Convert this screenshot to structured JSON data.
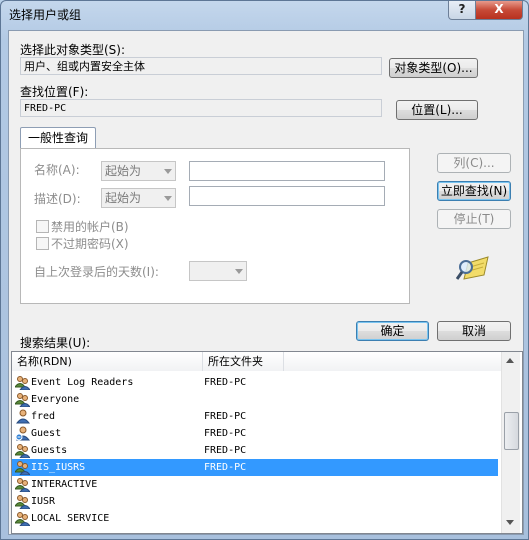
{
  "window": {
    "title": "选择用户或组",
    "help_label": "?",
    "close_label": "X"
  },
  "object_type": {
    "label": "选择此对象类型(S):",
    "value": "用户、组或内置安全主体",
    "button": "对象类型(O)..."
  },
  "location": {
    "label": "查找位置(F):",
    "value": "FRED-PC",
    "button": "位置(L)..."
  },
  "query": {
    "tab": "一般性查询",
    "name_label": "名称(A):",
    "name_mode": "起始为",
    "desc_label": "描述(D):",
    "desc_mode": "起始为",
    "disabled_accounts": "禁用的帐户(B)",
    "no_expire_password": "不过期密码(X)",
    "days_since_logon": "自上次登录后的天数(I):"
  },
  "side_buttons": {
    "columns": "列(C)...",
    "find_now": "立即查找(N)",
    "stop": "停止(T)"
  },
  "dialog_buttons": {
    "ok": "确定",
    "cancel": "取消"
  },
  "results": {
    "label": "搜索结果(U):",
    "columns": [
      "名称(RDN)",
      "所在文件夹"
    ],
    "rows": [
      {
        "name": "Event Log Readers",
        "folder": "FRED-PC",
        "icon": "group-icon",
        "selected": false
      },
      {
        "name": "Everyone",
        "folder": "",
        "icon": "group-icon",
        "selected": false
      },
      {
        "name": "fred",
        "folder": "FRED-PC",
        "icon": "user-icon",
        "selected": false
      },
      {
        "name": "Guest",
        "folder": "FRED-PC",
        "icon": "user-disabled-icon",
        "selected": false
      },
      {
        "name": "Guests",
        "folder": "FRED-PC",
        "icon": "group-icon",
        "selected": false
      },
      {
        "name": "IIS_IUSRS",
        "folder": "FRED-PC",
        "icon": "group-icon",
        "selected": true
      },
      {
        "name": "INTERACTIVE",
        "folder": "",
        "icon": "group-icon",
        "selected": false
      },
      {
        "name": "IUSR",
        "folder": "",
        "icon": "group-icon",
        "selected": false
      },
      {
        "name": "LOCAL SERVICE",
        "folder": "",
        "icon": "group-icon",
        "selected": false
      }
    ]
  },
  "colors": {
    "selection": "#3399ff",
    "disabled_text": "#8d8d8d",
    "close": "#c74a37"
  }
}
